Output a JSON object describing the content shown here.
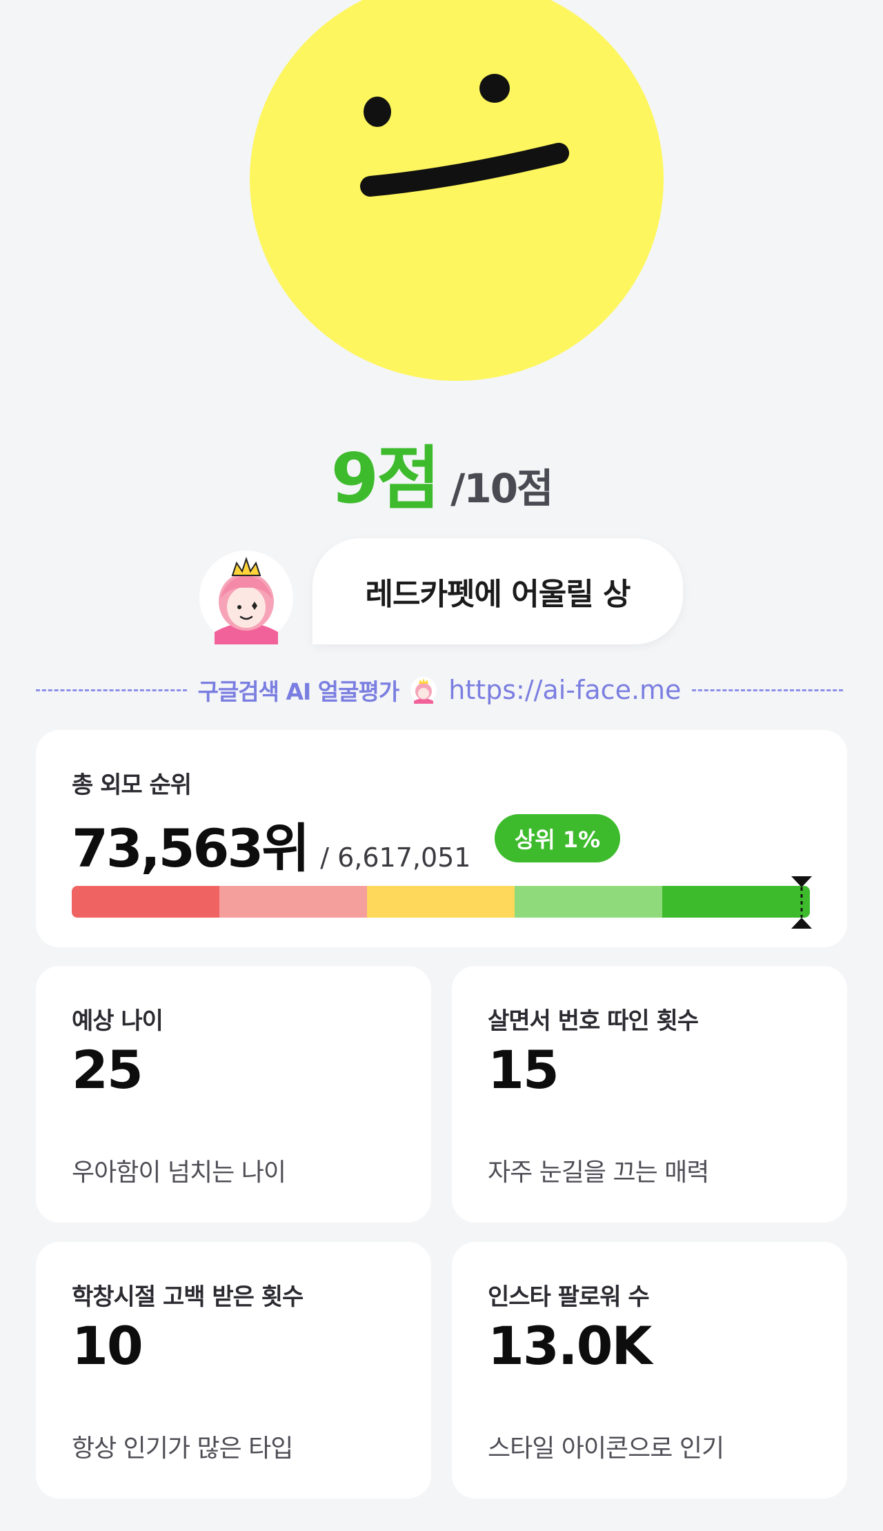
{
  "score": {
    "value": "9점",
    "total": "/10점"
  },
  "face_type": {
    "label": "레드카펫에 어울릴 상"
  },
  "promo": {
    "label": "구글검색 AI 얼굴평가",
    "url": "https://ai-face.me"
  },
  "ranking": {
    "title": "총 외모 순위",
    "rank": "73,563위",
    "total": "/ 6,617,051",
    "badge": "상위 1%",
    "percentile_fraction": 0.989,
    "bar_colors": [
      "#f06363",
      "#f59f9c",
      "#fdd85a",
      "#8fdb7b",
      "#3dbb2c"
    ]
  },
  "stats": [
    {
      "title": "예상 나이",
      "value": "25",
      "description": "우아함이 넘치는 나이"
    },
    {
      "title": "살면서 번호 따인 횟수",
      "value": "15",
      "description": "자주 눈길을 끄는 매력"
    },
    {
      "title": "학창시절 고백 받은 횟수",
      "value": "10",
      "description": "항상 인기가 많은 타입"
    },
    {
      "title": "인스타 팔로워 수",
      "value": "13.0K",
      "description": "스타일 아이콘으로 인기"
    }
  ],
  "colors": {
    "accent_green": "#3dbb2c",
    "promo_purple": "#7a7ee0",
    "background": "#f4f5f7"
  },
  "icons": {
    "photo": "smiley-face-icon",
    "mascot": "princess-mascot-icon"
  }
}
